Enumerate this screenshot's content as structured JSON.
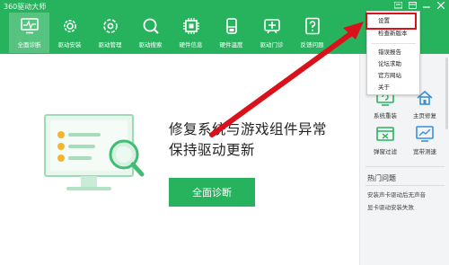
{
  "app": {
    "title": "360驱动大师"
  },
  "window_controls": [
    {
      "name": "menu-icon"
    },
    {
      "name": "skin-icon"
    },
    {
      "name": "minimize-icon"
    },
    {
      "name": "close-icon"
    }
  ],
  "toolbar": {
    "items": [
      {
        "label": "全面诊断",
        "icon": "monitor-pulse-icon",
        "active": true
      },
      {
        "label": "驱动安装",
        "icon": "gear-icon",
        "active": false
      },
      {
        "label": "驱动管理",
        "icon": "settings-icon",
        "active": false
      },
      {
        "label": "驱动搜索",
        "icon": "search-icon",
        "active": false
      },
      {
        "label": "硬件信息",
        "icon": "chip-icon",
        "active": false
      },
      {
        "label": "硬件温度",
        "icon": "thermometer-icon",
        "active": false
      },
      {
        "label": "驱动门诊",
        "icon": "stethoscope-icon",
        "active": false
      },
      {
        "label": "反馈问题",
        "icon": "question-icon",
        "active": false
      }
    ]
  },
  "main": {
    "headline_line1": "修复系统与游戏组件异常",
    "headline_line2": "保持驱动更新",
    "scan_button": "全面诊断"
  },
  "right_panel": {
    "tools": [
      {
        "label": "系统重装",
        "icon": "reinstall-icon"
      },
      {
        "label": "主页修复",
        "icon": "homepage-repair-icon"
      },
      {
        "label": "弹窗过滤",
        "icon": "popup-filter-icon"
      },
      {
        "label": "宽带测速",
        "icon": "speedtest-icon"
      }
    ],
    "hot_title": "热门问题",
    "hot_items": [
      "安装声卡驱动后无声音",
      "显卡驱动安装失败"
    ]
  },
  "menu": {
    "items": [
      "设置",
      "检查新版本",
      "错误报告",
      "论坛求助",
      "官方网站",
      "关于"
    ]
  },
  "colors": {
    "brand_green": "#27b35e",
    "annotation_red": "#d9111b"
  }
}
